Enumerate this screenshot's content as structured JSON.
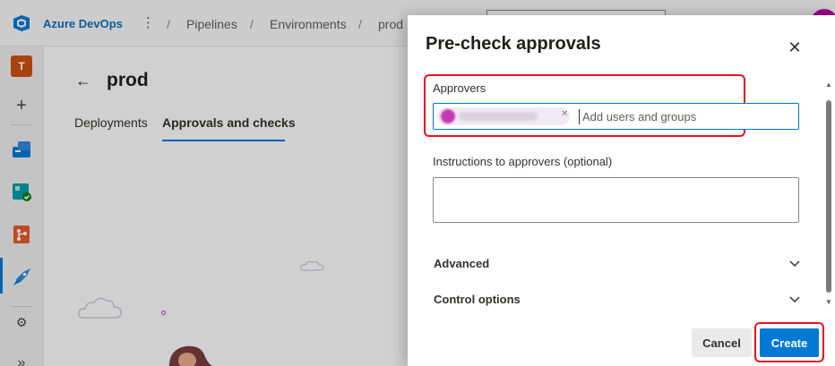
{
  "app": {
    "brand": "Azure DevOps"
  },
  "breadcrumb": [
    "Pipelines",
    "Environments",
    "prod"
  ],
  "rail": {
    "project_initial": "T"
  },
  "page": {
    "title": "prod",
    "tabs": [
      {
        "label": "Deployments",
        "active": false
      },
      {
        "label": "Approvals and checks",
        "active": true
      }
    ]
  },
  "dialog": {
    "title": "Pre-check approvals",
    "approvers_label": "Approvers",
    "approvers_placeholder": "Add users and groups",
    "instructions_label": "Instructions to approvers (optional)",
    "sections": [
      "Advanced",
      "Control options"
    ],
    "cancel_label": "Cancel",
    "create_label": "Create"
  },
  "colors": {
    "accent": "#0078d4",
    "highlight": "#e81123",
    "project": "#ca5010"
  }
}
